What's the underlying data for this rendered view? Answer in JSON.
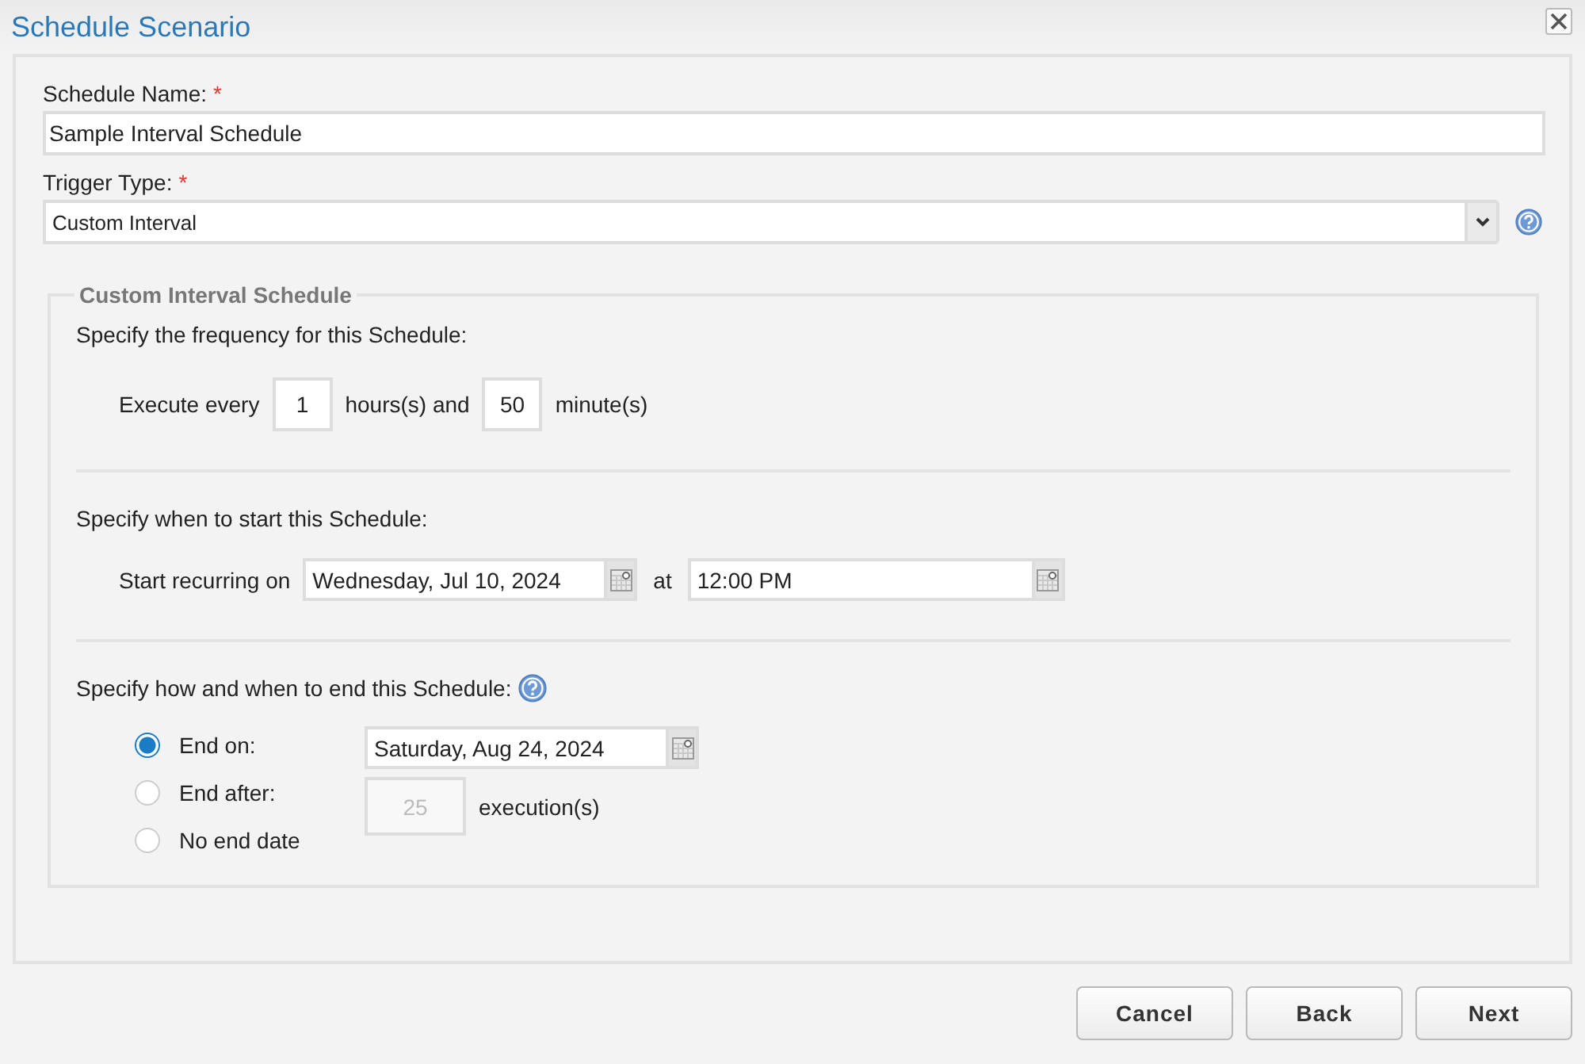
{
  "dialog": {
    "title": "Schedule Scenario"
  },
  "schedule_name": {
    "label": "Schedule Name:",
    "required_mark": "*",
    "value": "Sample Interval Schedule"
  },
  "trigger_type": {
    "label": "Trigger Type:",
    "required_mark": "*",
    "value": "Custom Interval"
  },
  "interval_group": {
    "legend": "Custom Interval Schedule",
    "frequency": {
      "prompt": "Specify the frequency for this Schedule:",
      "prefix": "Execute every",
      "hours": "1",
      "hours_unit": "hours(s) and",
      "minutes": "50",
      "minutes_unit": "minute(s)"
    },
    "start": {
      "prompt": "Specify when to start this Schedule:",
      "prefix": "Start recurring on",
      "date": "Wednesday, Jul 10, 2024",
      "at": "at",
      "time": "12:00 PM"
    },
    "end": {
      "prompt": "Specify how and when to end this Schedule:",
      "options": [
        {
          "label": "End on:",
          "selected": true
        },
        {
          "label": "End after:",
          "selected": false
        },
        {
          "label": "No end date",
          "selected": false
        }
      ],
      "end_date": "Saturday, Aug 24, 2024",
      "count": {
        "value": "25",
        "disabled": true
      },
      "count_unit": "execution(s)"
    }
  },
  "buttons": [
    {
      "label": "Cancel"
    },
    {
      "label": "Back"
    },
    {
      "label": "Next"
    }
  ]
}
